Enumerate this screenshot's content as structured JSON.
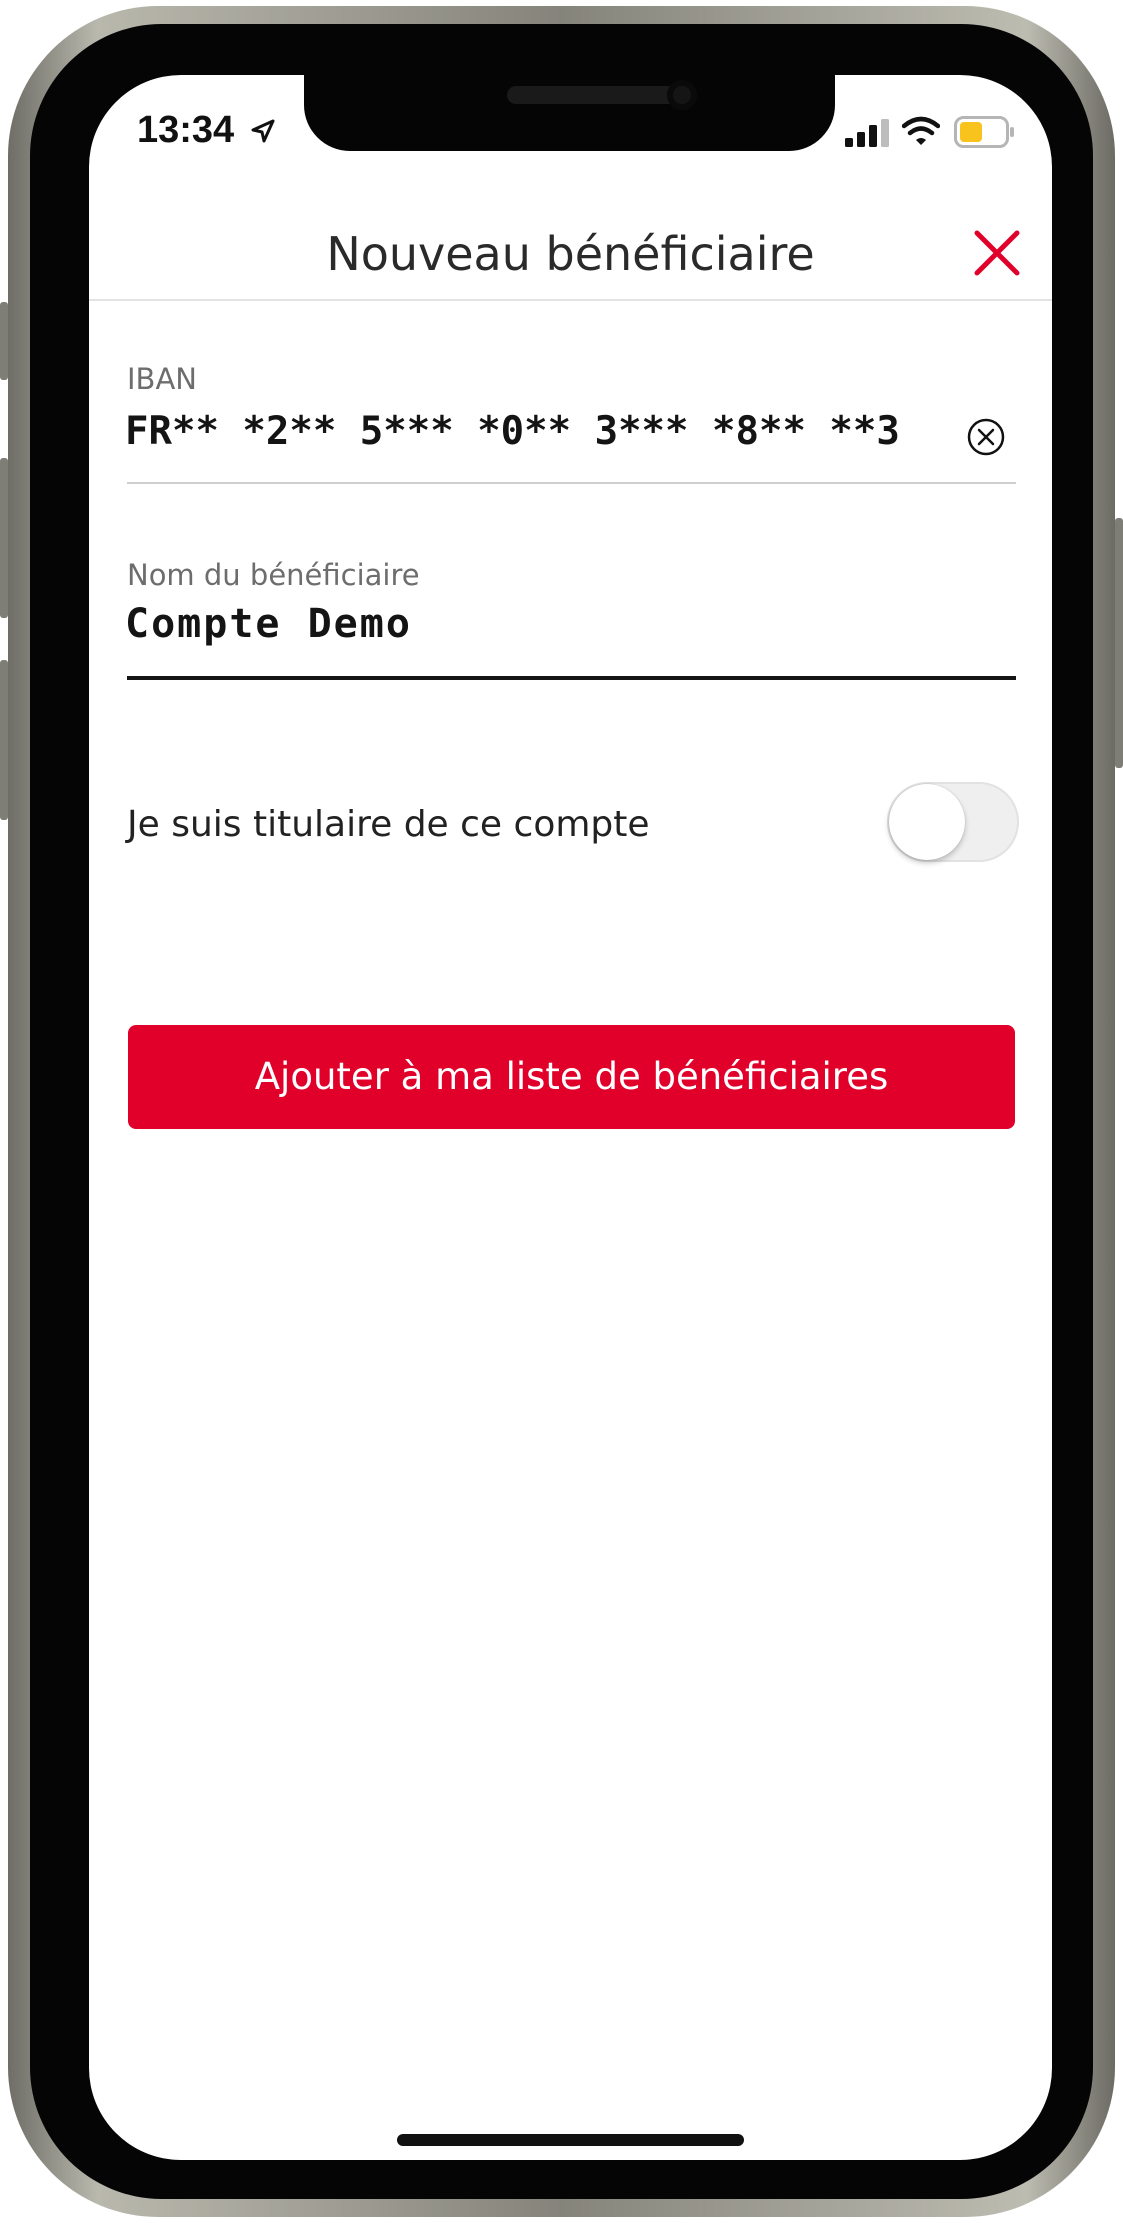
{
  "status_bar": {
    "time": "13:34",
    "icons": [
      "location-arrow-icon",
      "cellular-signal-icon",
      "wifi-icon",
      "battery-icon"
    ],
    "battery_color": "#f7c31c"
  },
  "header": {
    "title": "Nouveau bénéficiaire",
    "close_icon": "close-icon",
    "close_color": "#e1002a"
  },
  "form": {
    "iban": {
      "label": "IBAN",
      "value": "FR** *2** 5*** *0** 3*** *8** **3",
      "clear_icon": "clear-circle-x-icon"
    },
    "beneficiary_name": {
      "label": "Nom du bénéficiaire",
      "value": "Compte Demo"
    },
    "owner_toggle": {
      "label": "Je suis titulaire de ce compte",
      "checked": false
    }
  },
  "add_button": {
    "label": "Ajouter à ma liste de bénéficiaires",
    "color": "#e1002a"
  }
}
